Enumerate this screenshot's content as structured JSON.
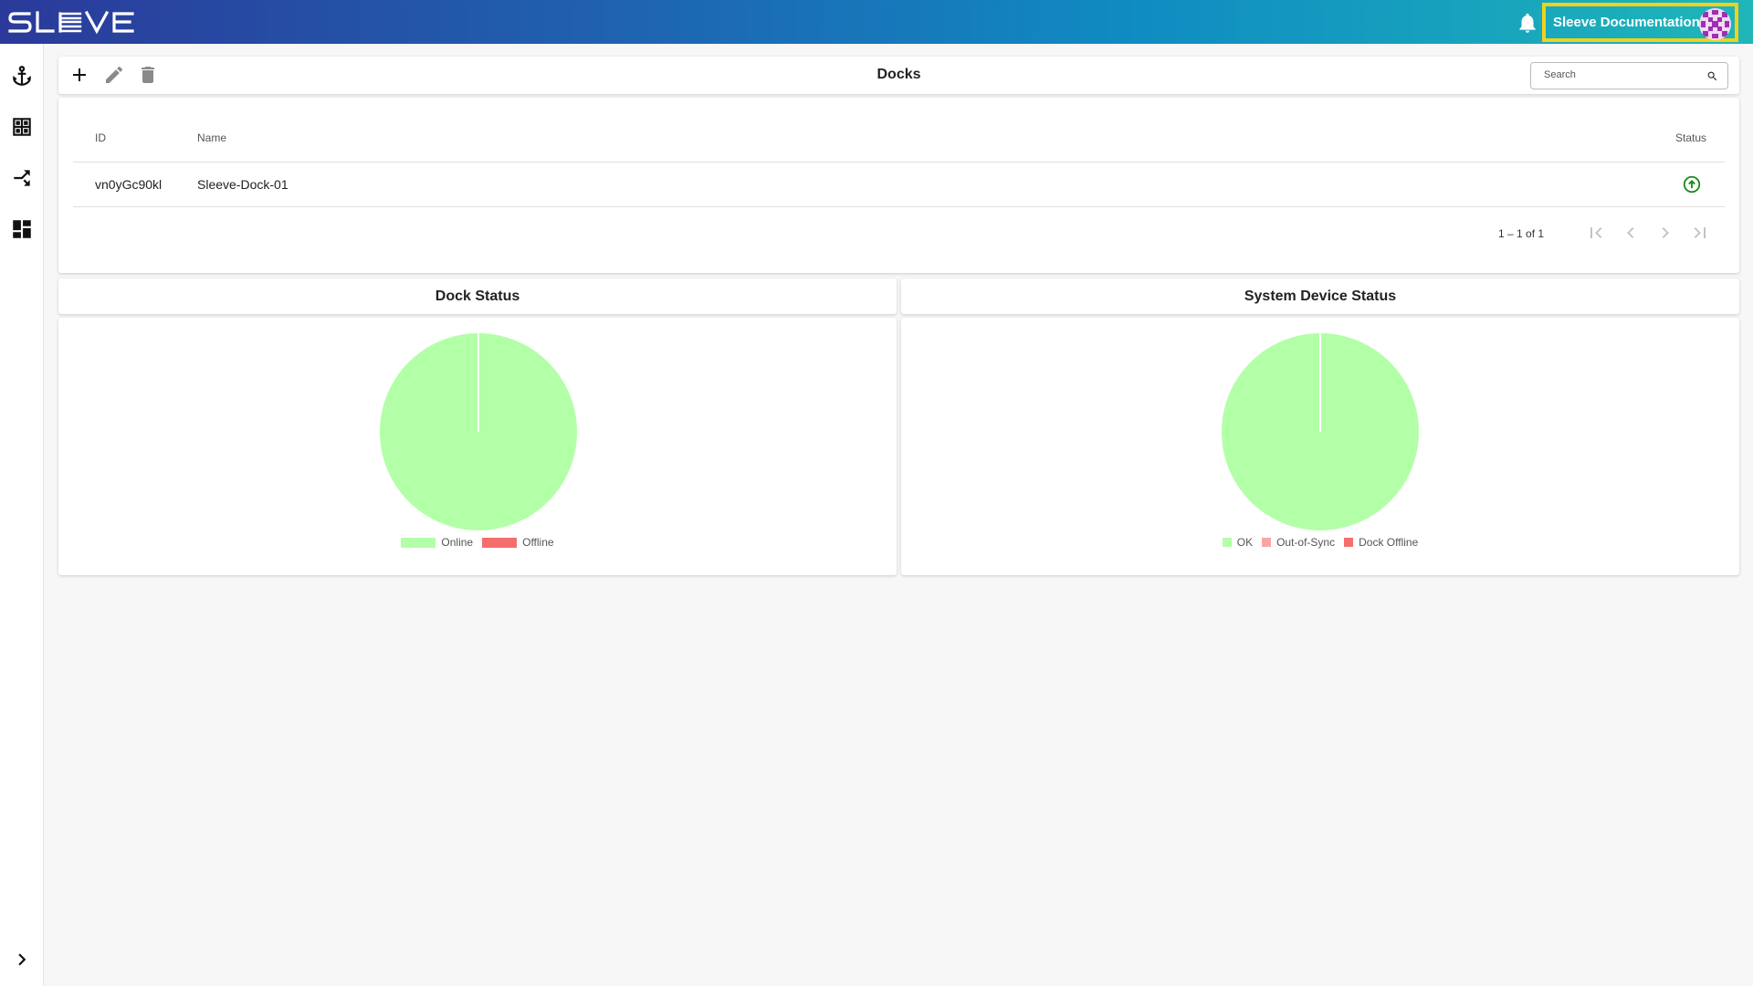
{
  "header": {
    "logo_text": "SLEEVE",
    "user_name": "Sleeve Documentation",
    "colors": {
      "highlight": "#f0d21c"
    }
  },
  "sidebar": {
    "items": [
      {
        "icon": "anchor-icon"
      },
      {
        "icon": "table-view-icon"
      },
      {
        "icon": "device-hub-icon"
      },
      {
        "icon": "dashboard-icon"
      }
    ],
    "expand_icon": "chevron-right-icon"
  },
  "toolbar": {
    "title": "Docks",
    "search_placeholder": "Search",
    "actions": [
      "add-icon",
      "edit-icon",
      "delete-icon"
    ]
  },
  "table": {
    "columns": [
      "ID",
      "Name",
      "Status"
    ],
    "rows": [
      {
        "id": "vn0yGc90kl",
        "name": "Sleeve-Dock-01",
        "status": "online"
      }
    ],
    "pagination": "1 – 1 of 1"
  },
  "charts": {
    "dock_status": {
      "title": "Dock Status",
      "legend": [
        "Online",
        "Offline"
      ]
    },
    "system_device_status": {
      "title": "System Device Status",
      "legend": [
        "OK",
        "Out-of-Sync",
        "Dock Offline"
      ]
    }
  },
  "chart_data": [
    {
      "type": "pie",
      "title": "Dock Status",
      "categories": [
        "Online",
        "Offline"
      ],
      "values": [
        1,
        0
      ],
      "colors": [
        "#b3ffa8",
        "#f56e6e"
      ],
      "legend": "bottom"
    },
    {
      "type": "pie",
      "title": "System Device Status",
      "categories": [
        "OK",
        "Out-of-Sync",
        "Dock Offline"
      ],
      "values": [
        1,
        0,
        0
      ],
      "colors": [
        "#b3ffa8",
        "#f7a6a6",
        "#f56e6e"
      ],
      "legend": "bottom"
    }
  ]
}
